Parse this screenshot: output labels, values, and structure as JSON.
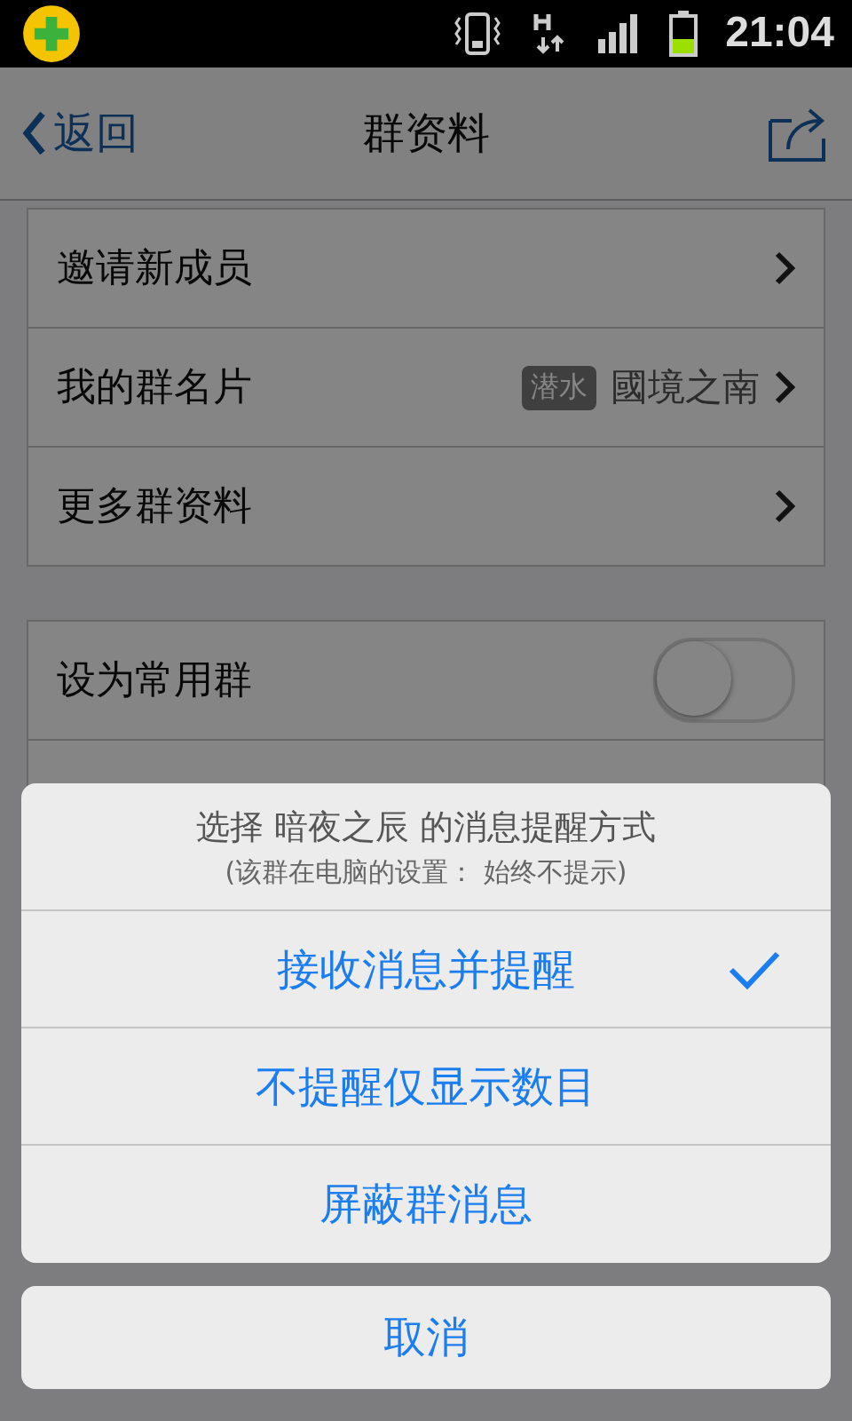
{
  "status_bar": {
    "time": "21:04"
  },
  "nav": {
    "back": "返回",
    "title": "群资料"
  },
  "groups": [
    [
      {
        "kind": "link",
        "label": "邀请新成员"
      },
      {
        "kind": "link",
        "label": "我的群名片",
        "badge": "潜水",
        "value": "國境之南"
      },
      {
        "kind": "link",
        "label": "更多群资料"
      }
    ],
    [
      {
        "kind": "switch",
        "label": "设为常用群",
        "on": false
      },
      {
        "kind": "blank"
      }
    ]
  ],
  "sheet": {
    "title": "选择 暗夜之辰 的消息提醒方式",
    "subtitle": "(该群在电脑的设置： 始终不提示)",
    "options": [
      {
        "label": "接收消息并提醒",
        "selected": true
      },
      {
        "label": "不提醒仅显示数目",
        "selected": false
      },
      {
        "label": "屏蔽群消息",
        "selected": false
      }
    ],
    "cancel": "取消"
  }
}
